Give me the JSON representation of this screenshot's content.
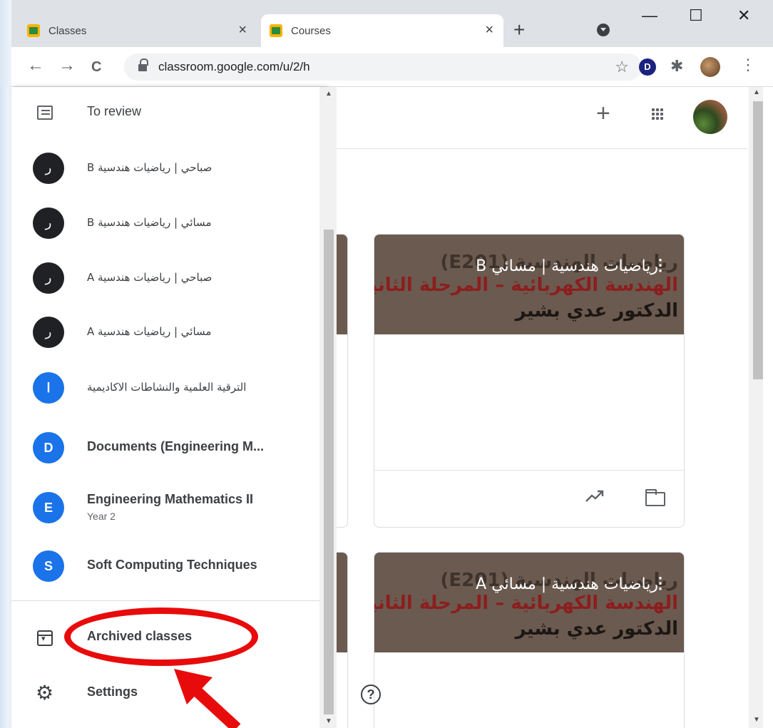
{
  "browser": {
    "tabs": [
      {
        "title": "Classes",
        "close": "×"
      },
      {
        "title": "Courses",
        "close": "×"
      }
    ],
    "new_tab": "+",
    "window_controls": {
      "minimize": "—",
      "maximize": "☐",
      "close": "✕"
    },
    "url": "classroom.google.com/u/2/h",
    "star": "☆",
    "extension_badge": "D",
    "menu": "⋮",
    "nav": {
      "back": "←",
      "forward": "→",
      "reload": "C"
    }
  },
  "header": {
    "add": "+"
  },
  "drawer": {
    "to_review": "To review",
    "classes": [
      {
        "avatar": "ر",
        "label": "B صباحي | رياضيات هندسية",
        "dark": true
      },
      {
        "avatar": "ر",
        "label": "B مسائي | رياضيات هندسية",
        "dark": true
      },
      {
        "avatar": "ر",
        "label": "A صباحي | رياضيات هندسية",
        "dark": true
      },
      {
        "avatar": "ر",
        "label": "A مسائي | رياضيات هندسية",
        "dark": true
      },
      {
        "avatar": "ا",
        "label": "الترقية العلمية والنشاطات الاكاديمية",
        "dark": false
      },
      {
        "avatar": "D",
        "label": "Documents (Engineering M...",
        "dark": false
      },
      {
        "avatar": "E",
        "label": "Engineering Mathematics II",
        "sub": "Year 2",
        "dark": false
      },
      {
        "avatar": "S",
        "label": "Soft Computing Techniques",
        "dark": false
      }
    ],
    "archived": "Archived classes",
    "settings": "Settings"
  },
  "cards": [
    {
      "title": "رياضيات هندسية | مسائي B",
      "banner_line1": "رياضيات الهندسية (E201)",
      "banner_line2": "الهندسة الكهربائية – المرحلة الثانية",
      "banner_line3": "الدكتور عدي بشير",
      "menu": "⋮"
    },
    {
      "title": "رياضيات هندسية | مسائي A",
      "banner_line1": "رياضيات الهندسية (E201)",
      "banner_line2": "الهندسة الكهربائية – المرحلة الثانية",
      "banner_line3": "الدكتور عدي بشير",
      "menu": "⋮"
    }
  ],
  "help": "?",
  "colors": {
    "annotation": "#e80b0b",
    "banner": "#6b5a4f",
    "avatar_blue": "#1a73e8",
    "avatar_dark": "#202124"
  }
}
